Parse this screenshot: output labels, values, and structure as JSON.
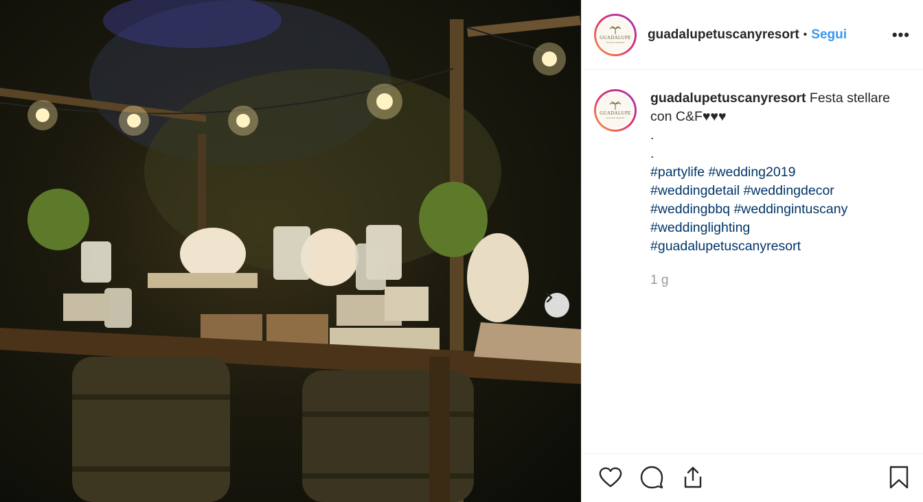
{
  "post": {
    "image_alt": "Outdoor wedding candy table with string lights at night",
    "next_icon": "chevron-right-icon"
  },
  "header": {
    "avatar_logo_text": "GUADALUPE",
    "avatar_logo_sub": "TUSCANY RESORT",
    "username": "guadalupetuscanyresort",
    "separator": "•",
    "follow_label": "Segui",
    "more_label": "•••"
  },
  "caption": {
    "username": "guadalupetuscanyresort",
    "text": "Festa stellare con C&F♥♥♥",
    "dot1": ".",
    "dot2": ".",
    "hashtags": [
      "#partylife",
      "#wedding2019",
      "#weddingdetail",
      "#weddingdecor",
      "#weddingbbq",
      "#weddingintuscany",
      "#weddinglighting",
      "#guadalupetuscanyresort"
    ],
    "time": "1 g"
  },
  "actions": {
    "like_icon": "heart-icon",
    "comment_icon": "comment-icon",
    "share_icon": "share-icon",
    "save_icon": "bookmark-icon"
  },
  "colors": {
    "link": "#3897f0",
    "hashtag": "#003569",
    "muted": "#999999"
  }
}
